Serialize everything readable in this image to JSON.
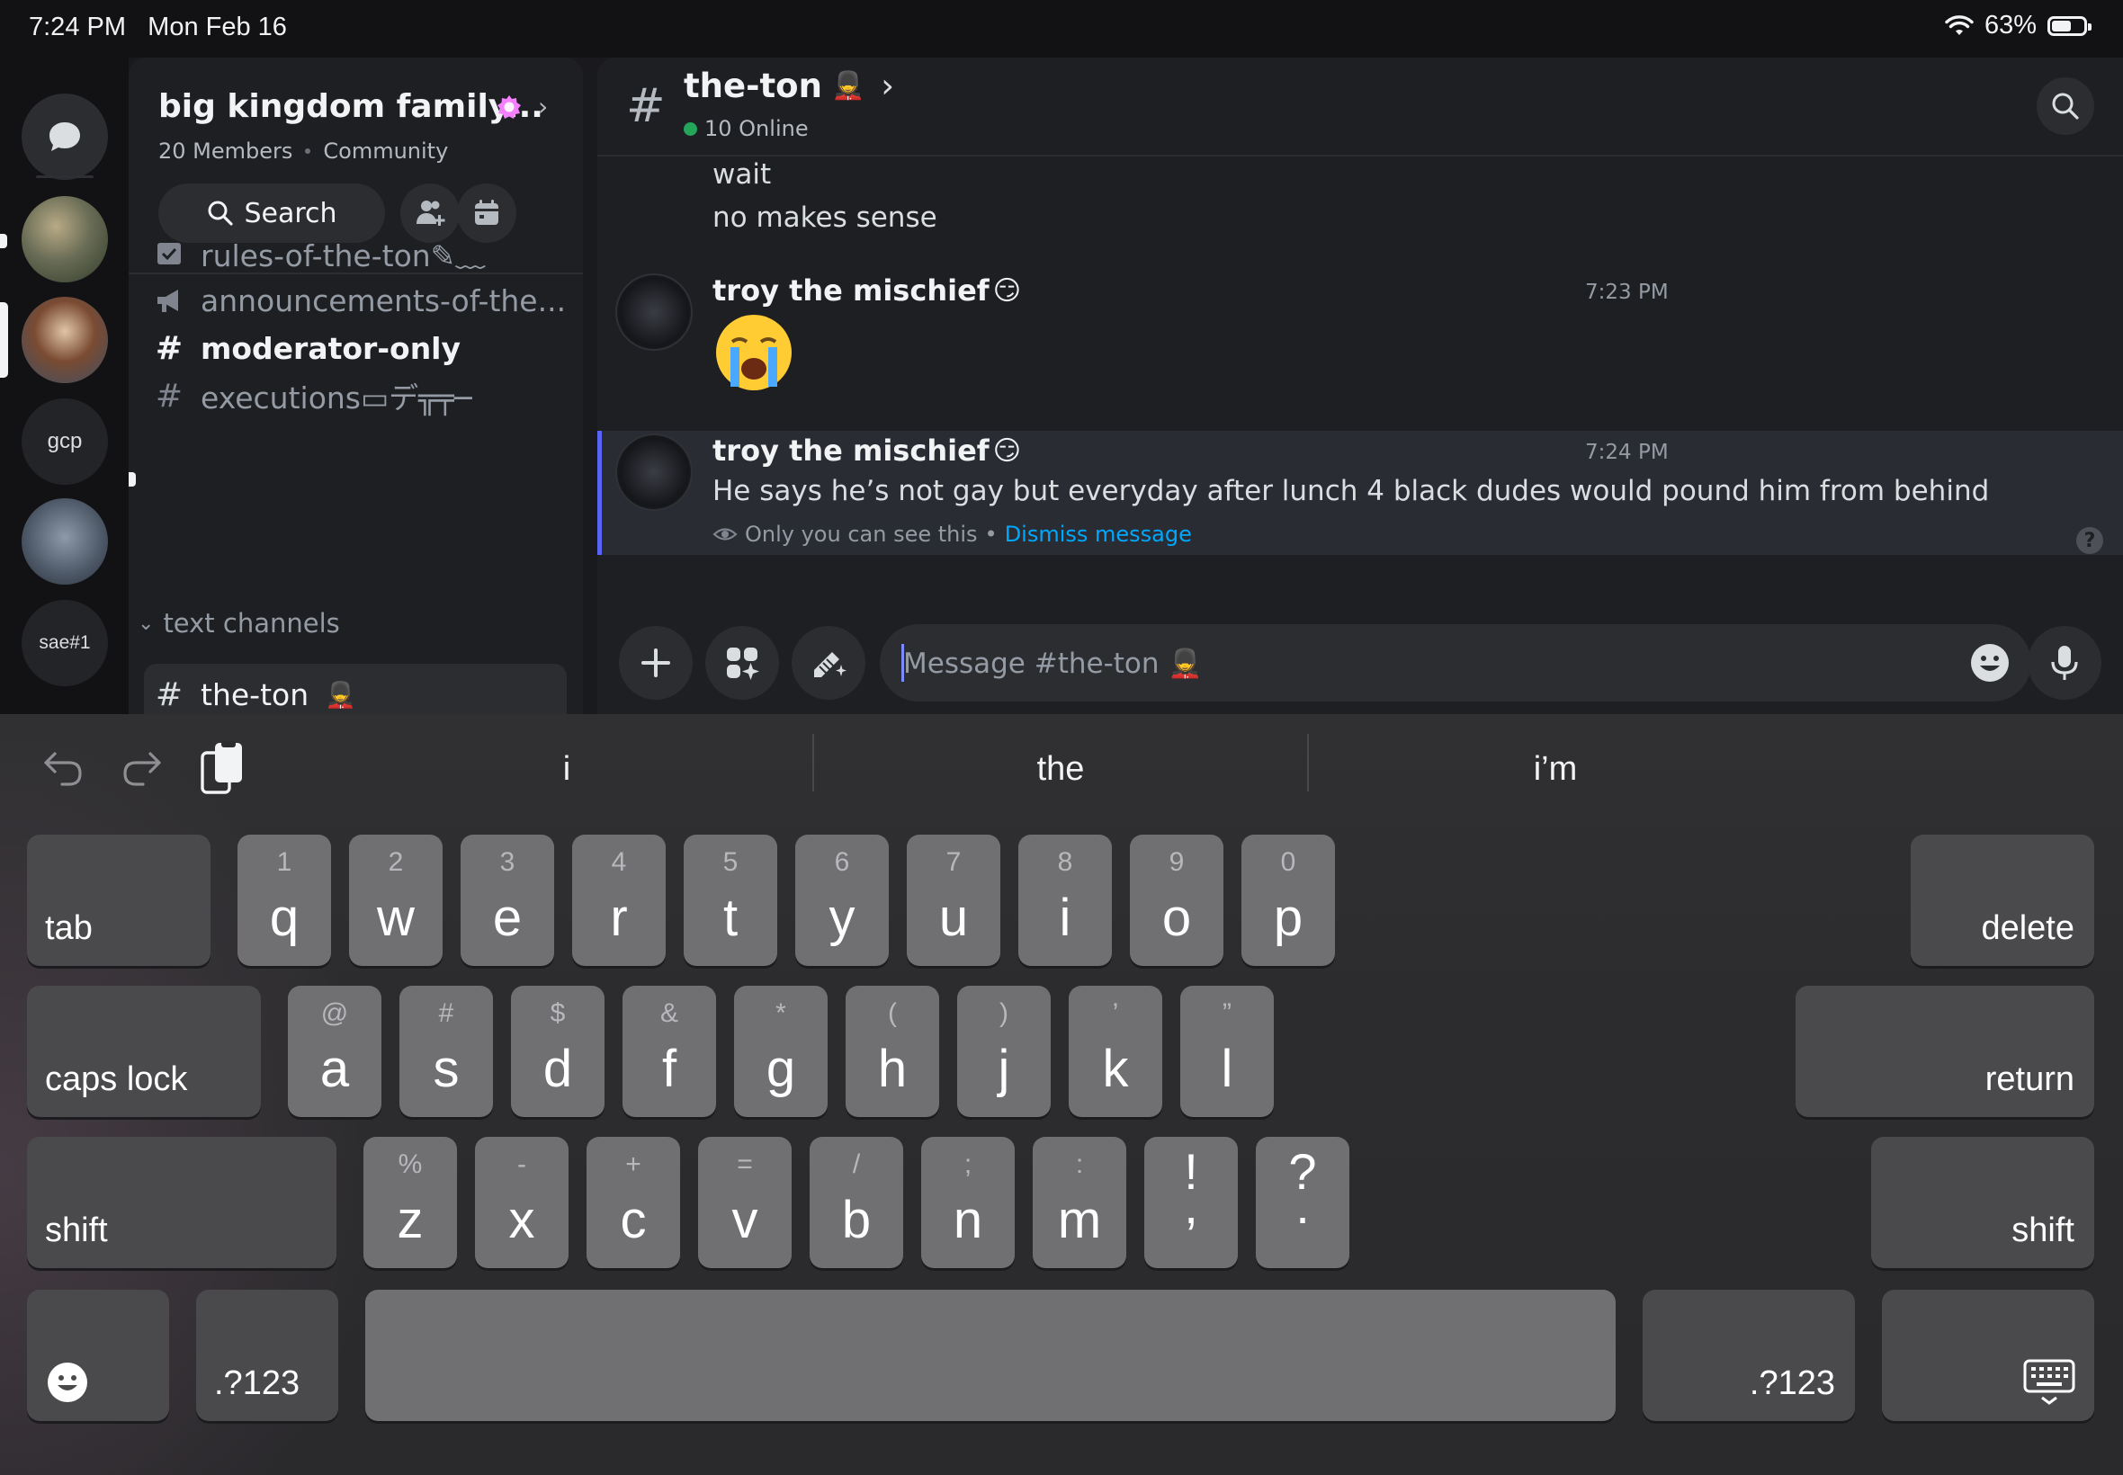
{
  "status_bar": {
    "time": "7:24 PM",
    "date": "Mon Feb 16",
    "battery_text": "63%",
    "battery_level": 0.63
  },
  "server_rail": {
    "gcp_label": "gcp",
    "sae_label": "sae#1"
  },
  "guild": {
    "name": "big kingdom family...",
    "member_count": "20 Members",
    "type": "Community",
    "search_label": "Search"
  },
  "channels": {
    "items": [
      {
        "name": "rules-of-the-ton✎﹏",
        "icon": "rules-icon"
      },
      {
        "name": "announcements-of-the...",
        "icon": "megaphone-icon"
      },
      {
        "name": "moderator-only",
        "icon": "hash-lock-icon"
      },
      {
        "name": "executions▭デ╦╤─",
        "icon": "hash-icon"
      }
    ],
    "category": "text channels",
    "selected": {
      "name": "the-ton",
      "emoji": "💂"
    }
  },
  "chat": {
    "header": {
      "channel": "the-ton",
      "emoji": "💂",
      "online": "10 Online"
    },
    "messages": {
      "prev_line1": "wait",
      "prev_line2": "no makes sense",
      "m1": {
        "author": "troy the mischief",
        "emoji": "😏",
        "time": "7:23 PM",
        "content_emoji": "😭"
      },
      "m2": {
        "author": "troy the mischief",
        "emoji": "😏",
        "time": "7:24 PM",
        "text": "He says he’s not gay but everyday after lunch 4 black dudes would pound him from behind",
        "note": "Only you can see this",
        "note_sep": "•",
        "dismiss": "Dismiss message",
        "help": "?"
      }
    },
    "composer": {
      "placeholder": "Message #the-ton 💂"
    }
  },
  "keyboard": {
    "suggestions": [
      "i",
      "the",
      "i’m"
    ],
    "row1": [
      {
        "main": "q",
        "alt": "1"
      },
      {
        "main": "w",
        "alt": "2"
      },
      {
        "main": "e",
        "alt": "3"
      },
      {
        "main": "r",
        "alt": "4"
      },
      {
        "main": "t",
        "alt": "5"
      },
      {
        "main": "y",
        "alt": "6"
      },
      {
        "main": "u",
        "alt": "7"
      },
      {
        "main": "i",
        "alt": "8"
      },
      {
        "main": "o",
        "alt": "9"
      },
      {
        "main": "p",
        "alt": "0"
      }
    ],
    "row2": [
      {
        "main": "a",
        "alt": "@"
      },
      {
        "main": "s",
        "alt": "#"
      },
      {
        "main": "d",
        "alt": "$"
      },
      {
        "main": "f",
        "alt": "&"
      },
      {
        "main": "g",
        "alt": "*"
      },
      {
        "main": "h",
        "alt": "("
      },
      {
        "main": "j",
        "alt": ")"
      },
      {
        "main": "k",
        "alt": "’"
      },
      {
        "main": "l",
        "alt": "”"
      }
    ],
    "row3": [
      {
        "main": "z",
        "alt": "%"
      },
      {
        "main": "x",
        "alt": "-"
      },
      {
        "main": "c",
        "alt": "+"
      },
      {
        "main": "v",
        "alt": "="
      },
      {
        "main": "b",
        "alt": "/"
      },
      {
        "main": "n",
        "alt": ";"
      },
      {
        "main": "m",
        "alt": ":"
      }
    ],
    "punct": [
      {
        "top": "!",
        "bottom": ","
      },
      {
        "top": "?",
        "bottom": "."
      }
    ],
    "labels": {
      "tab": "tab",
      "delete": "delete",
      "caps_lock": "caps lock",
      "return": "return",
      "shift_left": "shift",
      "shift_right": "shift",
      "numbers_left": ".?123",
      "numbers_right": ".?123"
    }
  },
  "colors": {
    "accent": "#5865f2",
    "link": "#00a8fc",
    "online": "#23a55a",
    "boost": "#f47fff"
  }
}
